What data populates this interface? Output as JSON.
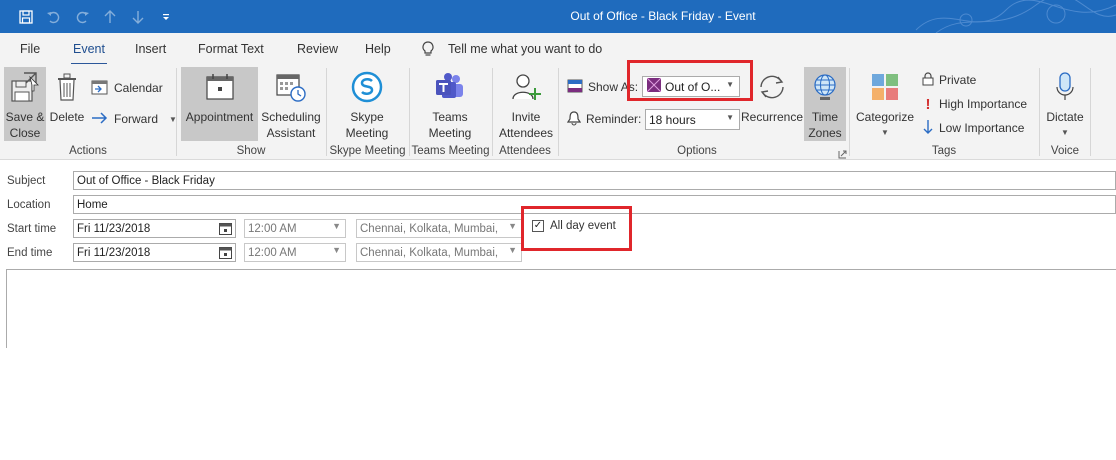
{
  "window": {
    "title": "Out of Office - Black Friday  -  Event",
    "qat": [
      "save-icon",
      "undo-icon",
      "redo-icon",
      "up-icon",
      "down-icon",
      "customize-icon"
    ]
  },
  "menu": {
    "tabs": [
      "File",
      "Event",
      "Insert",
      "Format Text",
      "Review",
      "Help"
    ],
    "active": "Event",
    "tell_me": "Tell me what you want to do"
  },
  "ribbon": {
    "actions": {
      "save_close_1": "Save &",
      "save_close_2": "Close",
      "delete": "Delete",
      "calendar": "Calendar",
      "forward": "Forward",
      "label": "Actions"
    },
    "show": {
      "appointment": "Appointment",
      "scheduling_1": "Scheduling",
      "scheduling_2": "Assistant",
      "label": "Show"
    },
    "skype": {
      "line1": "Skype",
      "line2": "Meeting",
      "label": "Skype Meeting"
    },
    "teams": {
      "line1": "Teams",
      "line2": "Meeting",
      "label": "Teams Meeting"
    },
    "attendees": {
      "line1": "Invite",
      "line2": "Attendees",
      "label": "Attendees"
    },
    "options": {
      "show_as_label": "Show As:",
      "show_as_value": "Out of O...",
      "reminder_label": "Reminder:",
      "reminder_value": "18 hours",
      "recurrence": "Recurrence",
      "time_zones_1": "Time",
      "time_zones_2": "Zones",
      "label": "Options"
    },
    "tags": {
      "categorize": "Categorize",
      "private": "Private",
      "high": "High Importance",
      "low": "Low Importance",
      "label": "Tags"
    },
    "voice": {
      "dictate": "Dictate",
      "label": "Voice"
    }
  },
  "form": {
    "subject_label": "Subject",
    "subject_value": "Out of Office - Black Friday",
    "location_label": "Location",
    "location_value": "Home",
    "start_label": "Start time",
    "start_date": "Fri 11/23/2018",
    "start_time": "12:00 AM",
    "start_tz": "Chennai, Kolkata, Mumbai,",
    "end_label": "End time",
    "end_date": "Fri 11/23/2018",
    "end_time": "12:00 AM",
    "end_tz": "Chennai, Kolkata, Mumbai,",
    "all_day_label": "All day event",
    "all_day_checked": true
  },
  "colors": {
    "titlebar": "#1f6bbd",
    "ribbon_bg": "#f3f3f3",
    "highlight_box": "#e0262b",
    "show_as_swatch": "#7b2d7f"
  }
}
